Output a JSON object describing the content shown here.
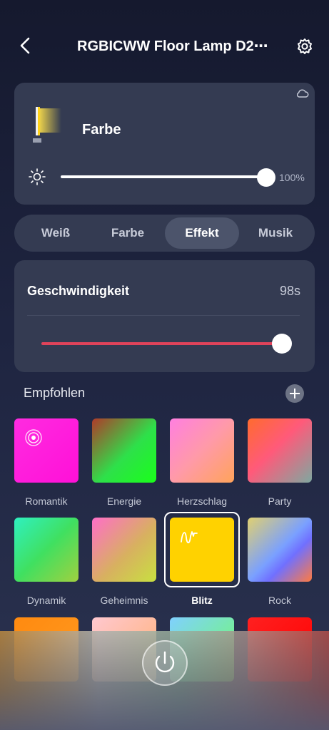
{
  "header": {
    "title": "RGBICWW Floor Lamp D2⋯",
    "back_icon": "chevron-left-icon",
    "settings_icon": "gear-icon"
  },
  "device_card": {
    "mode_title": "Farbe",
    "cloud_icon": "cloud-icon",
    "lamp_icon": "floor-lamp-icon",
    "brightness_icon": "sun-icon",
    "brightness_value": "100%",
    "brightness_level": 1.0
  },
  "tabs": [
    {
      "label": "Weiß",
      "active": false
    },
    {
      "label": "Farbe",
      "active": false
    },
    {
      "label": "Effekt",
      "active": true
    },
    {
      "label": "Musik",
      "active": false
    }
  ],
  "speed": {
    "label": "Geschwindigkeit",
    "value": "98s",
    "level": 0.98,
    "track_color": "#e0435a"
  },
  "recommended": {
    "title": "Empfohlen",
    "add_icon": "plus-icon",
    "items": [
      {
        "label": "Romantik",
        "icon": "rings-icon"
      },
      {
        "label": "Energie"
      },
      {
        "label": "Herzschlag"
      },
      {
        "label": "Party"
      },
      {
        "label": "Dynamik"
      },
      {
        "label": "Geheimnis"
      },
      {
        "label": "Blitz",
        "selected": true,
        "icon": "lightning-wave-icon"
      },
      {
        "label": "Rock"
      }
    ]
  },
  "bottom_bar": {
    "power_icon": "power-icon"
  },
  "colors": {
    "accent_red": "#e0435a",
    "selected_tile": "#ffd200",
    "card_bg": "#343b52"
  }
}
